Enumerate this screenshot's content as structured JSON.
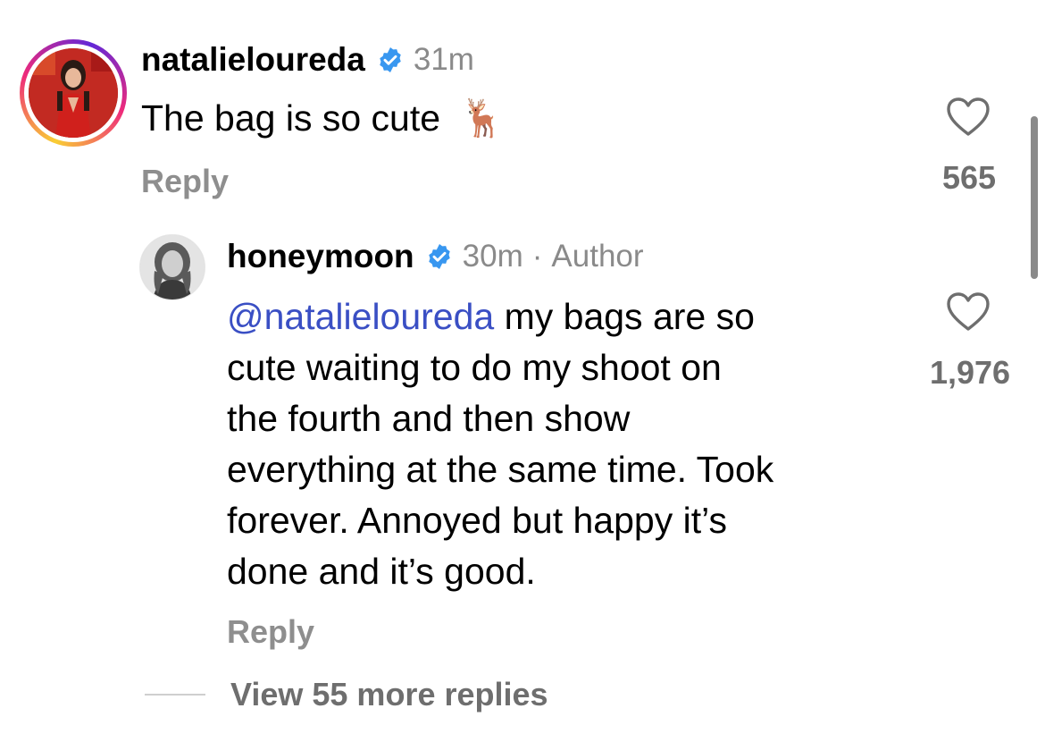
{
  "comments": [
    {
      "username": "natalieloureda",
      "verified": true,
      "time": "31m",
      "text": "The bag is so cute",
      "emoji": "🦌",
      "reply_label": "Reply",
      "like_count": "565",
      "avatar_icon": "avatar-photo-red-dress"
    }
  ],
  "reply": {
    "username": "honeymoon",
    "verified": true,
    "time": "30m",
    "separator": "·",
    "author_tag": "Author",
    "mention": "@natalieloureda",
    "text_lines": [
      " my bags are so",
      "cute waiting to do my shoot on",
      "the fourth and then show",
      "everything at the same time. Took",
      "forever. Annoyed but happy it’s",
      "done and it’s good."
    ],
    "reply_label": "Reply",
    "like_count": "1,976",
    "avatar_icon": "avatar-photo-grayscale"
  },
  "view_more": {
    "label": "View 55 more replies"
  },
  "colors": {
    "mention": "#3a4fc4",
    "verified": "#3897f0",
    "secondary_text": "#8a8a8a"
  }
}
